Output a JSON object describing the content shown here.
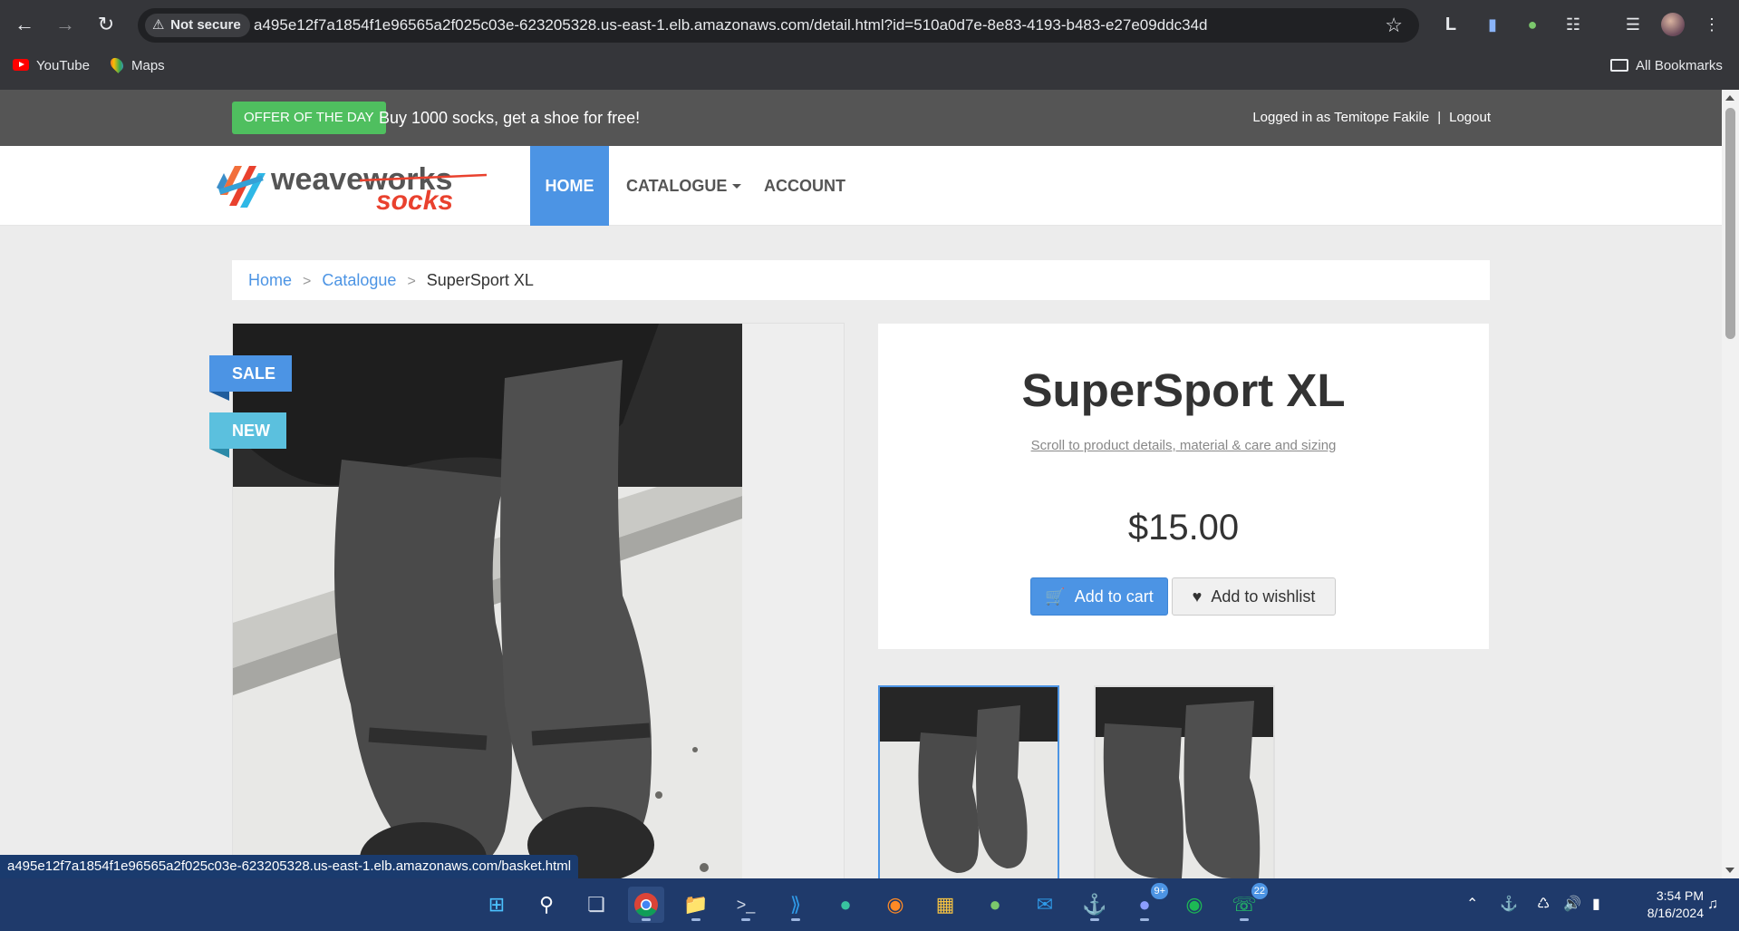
{
  "browser": {
    "security_label": "Not secure",
    "url": "a495e12f7a1854f1e96565a2f025c03e-623205328.us-east-1.elb.amazonaws.com/detail.html?id=510a0d7e-8e83-4193-b483-e27e09ddc34d",
    "bookmarks": [
      "YouTube",
      "Maps"
    ],
    "all_bookmarks_label": "All Bookmarks",
    "status_url": "a495e12f7a1854f1e96565a2f025c03e-623205328.us-east-1.elb.amazonaws.com/basket.html"
  },
  "offer": {
    "badge": "OFFER OF THE DAY",
    "text": "Buy 1000 socks, get a shoe for free!"
  },
  "user": {
    "logged_in_text": "Logged in as Temitope Fakile",
    "separator": "|",
    "logout_label": "Logout"
  },
  "logo": {
    "line1": "weaveworks",
    "line2": "socks"
  },
  "nav": {
    "items": [
      {
        "label": "HOME",
        "active": true
      },
      {
        "label": "CATALOGUE",
        "active": false
      },
      {
        "label": "ACCOUNT",
        "active": false
      }
    ]
  },
  "breadcrumb": {
    "home": "Home",
    "catalogue": "Catalogue",
    "current": "SuperSport XL",
    "separator": ">"
  },
  "product": {
    "ribbons": [
      "SALE",
      "NEW"
    ],
    "name": "SuperSport XL",
    "scroll_link": "Scroll to product details, material & care and sizing",
    "price": "$15.00",
    "add_to_cart_label": "Add to cart",
    "add_to_wishlist_label": "Add to wishlist"
  },
  "taskbar": {
    "apps": [
      "windows-start",
      "search",
      "task-view",
      "chrome",
      "file-explorer",
      "terminal",
      "vscode",
      "edge",
      "firefox",
      "microsoft-store",
      "photos",
      "outlook",
      "docker",
      "discord",
      "spotify",
      "whatsapp"
    ],
    "discord_badge": "9+",
    "whatsapp_badge": "22",
    "time": "3:54 PM",
    "date": "8/16/2024"
  },
  "colors": {
    "accent": "#4c94e4",
    "offer_green": "#4fbf5f",
    "offer_bar": "#555555",
    "taskbar": "#1f3a6b"
  }
}
